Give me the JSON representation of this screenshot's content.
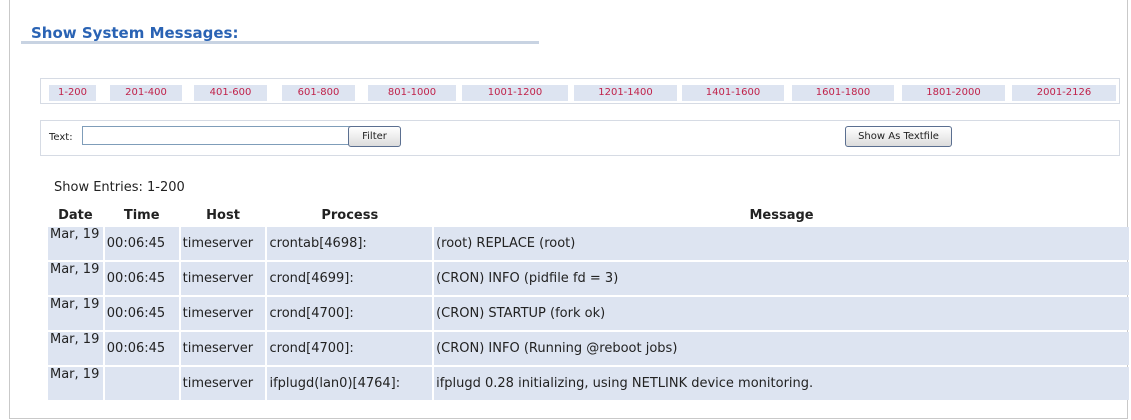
{
  "header": {
    "title": "Show System Messages:"
  },
  "ranges": [
    "1-200",
    "201-400",
    "401-600",
    "601-800",
    "801-1000",
    "1001-1200",
    "1201-1400",
    "1401-1600",
    "1601-1800",
    "1801-2000",
    "2001-2126"
  ],
  "filter": {
    "text_label": "Text:",
    "text_value": "",
    "filter_button": "Filter",
    "textfile_button": "Show As Textfile"
  },
  "entries_label": "Show Entries: 1-200",
  "table": {
    "headers": {
      "date": "Date",
      "time": "Time",
      "host": "Host",
      "process": "Process",
      "message": "Message"
    },
    "rows": [
      {
        "date": "Mar, 19",
        "time": "00:06:45",
        "host": "timeserver",
        "process": "crontab[4698]:",
        "message": "(root) REPLACE (root)"
      },
      {
        "date": "Mar, 19",
        "time": "00:06:45",
        "host": "timeserver",
        "process": "crond[4699]:",
        "message": "(CRON) INFO (pidfile fd = 3)"
      },
      {
        "date": "Mar, 19",
        "time": "00:06:45",
        "host": "timeserver",
        "process": "crond[4700]:",
        "message": "(CRON) STARTUP (fork ok)"
      },
      {
        "date": "Mar, 19",
        "time": "00:06:45",
        "host": "timeserver",
        "process": "crond[4700]:",
        "message": "(CRON) INFO (Running @reboot jobs)"
      },
      {
        "date": "Mar, 19",
        "time": "",
        "host": "timeserver",
        "process": "ifplugd(lan0)[4764]:",
        "message": "ifplugd 0.28 initializing, using NETLINK device monitoring."
      }
    ]
  },
  "colors": {
    "title": "#2a63b4",
    "link": "#c0224a",
    "cell_bg": "#dde4f1",
    "title_underline": "#c8d3e2"
  }
}
